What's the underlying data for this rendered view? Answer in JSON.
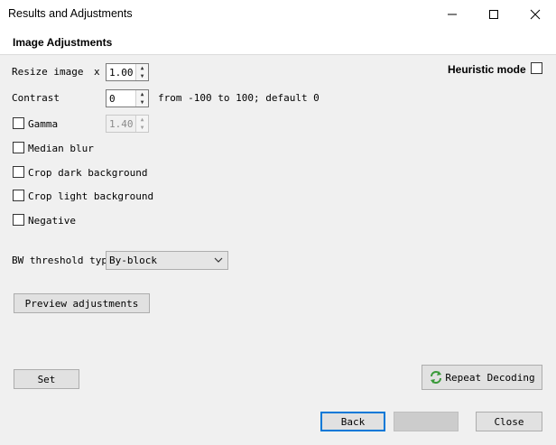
{
  "window": {
    "title": "Results and Adjustments"
  },
  "section": {
    "heading": "Image Adjustments"
  },
  "resize": {
    "label": "Resize image",
    "multiplier": "x",
    "value": "1.00"
  },
  "heuristic": {
    "label": "Heuristic mode",
    "checked": false
  },
  "contrast": {
    "label": "Contrast",
    "value": "0",
    "hint": "from -100 to 100; default 0"
  },
  "gamma": {
    "label": "Gamma",
    "value": "1.40",
    "checked": false
  },
  "median_blur": {
    "label": "Median blur",
    "checked": false
  },
  "crop_dark": {
    "label": "Crop dark background",
    "checked": false
  },
  "crop_light": {
    "label": "Crop light background",
    "checked": false
  },
  "negative": {
    "label": "Negative",
    "checked": false
  },
  "bw_threshold": {
    "label": "BW threshold type",
    "selected": "By-block"
  },
  "buttons": {
    "preview": "Preview adjustments",
    "set": "Set",
    "repeat": "Repeat Decoding",
    "back": "Back",
    "next": "",
    "close": "Close"
  },
  "colors": {
    "accent": "#0078d7",
    "repeat_icon": "#3a9a3a"
  }
}
